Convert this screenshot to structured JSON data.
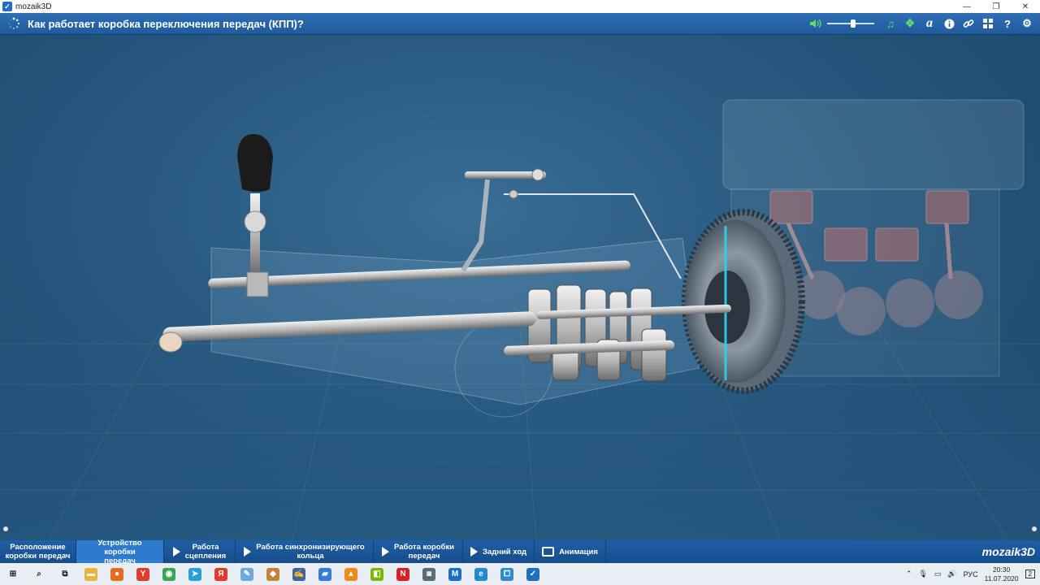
{
  "window": {
    "title": "mozaik3D",
    "minimize": "—",
    "restore": "❐",
    "close": "✕"
  },
  "header": {
    "title": "Как работает коробка переключения передач (КПП)?",
    "volume_level": 0.55,
    "tools": [
      {
        "name": "volume-icon",
        "glyph": "◀)"
      },
      {
        "name": "music-icon",
        "glyph": "♫"
      },
      {
        "name": "move-icon",
        "glyph": "✥"
      },
      {
        "name": "text-icon",
        "glyph": "a"
      },
      {
        "name": "info-icon",
        "glyph": "ℹ"
      },
      {
        "name": "link-icon",
        "glyph": "⚭"
      },
      {
        "name": "grid-icon",
        "glyph": "▦"
      },
      {
        "name": "help-icon",
        "glyph": "?"
      },
      {
        "name": "settings-icon",
        "glyph": "⚙"
      }
    ]
  },
  "nav": {
    "items": [
      {
        "label": "Расположение\nкоробки передач",
        "icon": "",
        "active": false
      },
      {
        "label": "Устройство коробки\nпередач",
        "icon": "",
        "active": true
      },
      {
        "label": "Работа\nсцепления",
        "icon": "play",
        "active": false
      },
      {
        "label": "Работа синхронизирующего\nкольца",
        "icon": "play",
        "active": false
      },
      {
        "label": "Работа коробки\nпередач",
        "icon": "play",
        "active": false
      },
      {
        "label": "Задний ход",
        "icon": "play",
        "active": false
      },
      {
        "label": "Анимация",
        "icon": "tv",
        "active": false
      }
    ],
    "brand": "mozaik3D"
  },
  "taskbar": {
    "apps": [
      {
        "name": "start-icon",
        "glyph": "⊞",
        "color": "#1a1a1a"
      },
      {
        "name": "search-icon",
        "glyph": "⌕",
        "color": "#1a1a1a"
      },
      {
        "name": "task-view-icon",
        "glyph": "⧉",
        "color": "#1a1a1a"
      },
      {
        "name": "explorer-icon",
        "glyph": "▬",
        "color": "#e8b43a"
      },
      {
        "name": "firefox-icon",
        "glyph": "●",
        "color": "#e66a1f"
      },
      {
        "name": "yandex-browser-icon",
        "glyph": "Y",
        "color": "#e23b2e"
      },
      {
        "name": "chrome-icon",
        "glyph": "◉",
        "color": "#3aa655"
      },
      {
        "name": "telegram-icon",
        "glyph": "➤",
        "color": "#2b9fd9"
      },
      {
        "name": "yandex-icon",
        "glyph": "Я",
        "color": "#e23b2e"
      },
      {
        "name": "paint-icon",
        "glyph": "✎",
        "color": "#6fa8dc"
      },
      {
        "name": "app-icon",
        "glyph": "◆",
        "color": "#c0853a"
      },
      {
        "name": "editor-icon",
        "glyph": "✍",
        "color": "#3a63a8"
      },
      {
        "name": "app2-icon",
        "glyph": "▰",
        "color": "#3a7bd5"
      },
      {
        "name": "vlc-icon",
        "glyph": "▲",
        "color": "#f08a1c"
      },
      {
        "name": "nvidia-icon",
        "glyph": "◧",
        "color": "#76b900"
      },
      {
        "name": "netflix-icon",
        "glyph": "N",
        "color": "#d81f26"
      },
      {
        "name": "camera-icon",
        "glyph": "◙",
        "color": "#5a6b7a"
      },
      {
        "name": "mozaik-m-icon",
        "glyph": "M",
        "color": "#1f6fc0"
      },
      {
        "name": "edge-icon",
        "glyph": "e",
        "color": "#1f8bd0"
      },
      {
        "name": "app3-icon",
        "glyph": "⧠",
        "color": "#2f8ad0"
      },
      {
        "name": "mozaik-app-icon",
        "glyph": "✓",
        "color": "#1f6fc0"
      }
    ],
    "tray": {
      "lang": "РУС",
      "time": "20:30",
      "date": "11.07.2020",
      "notifications": "2"
    }
  }
}
